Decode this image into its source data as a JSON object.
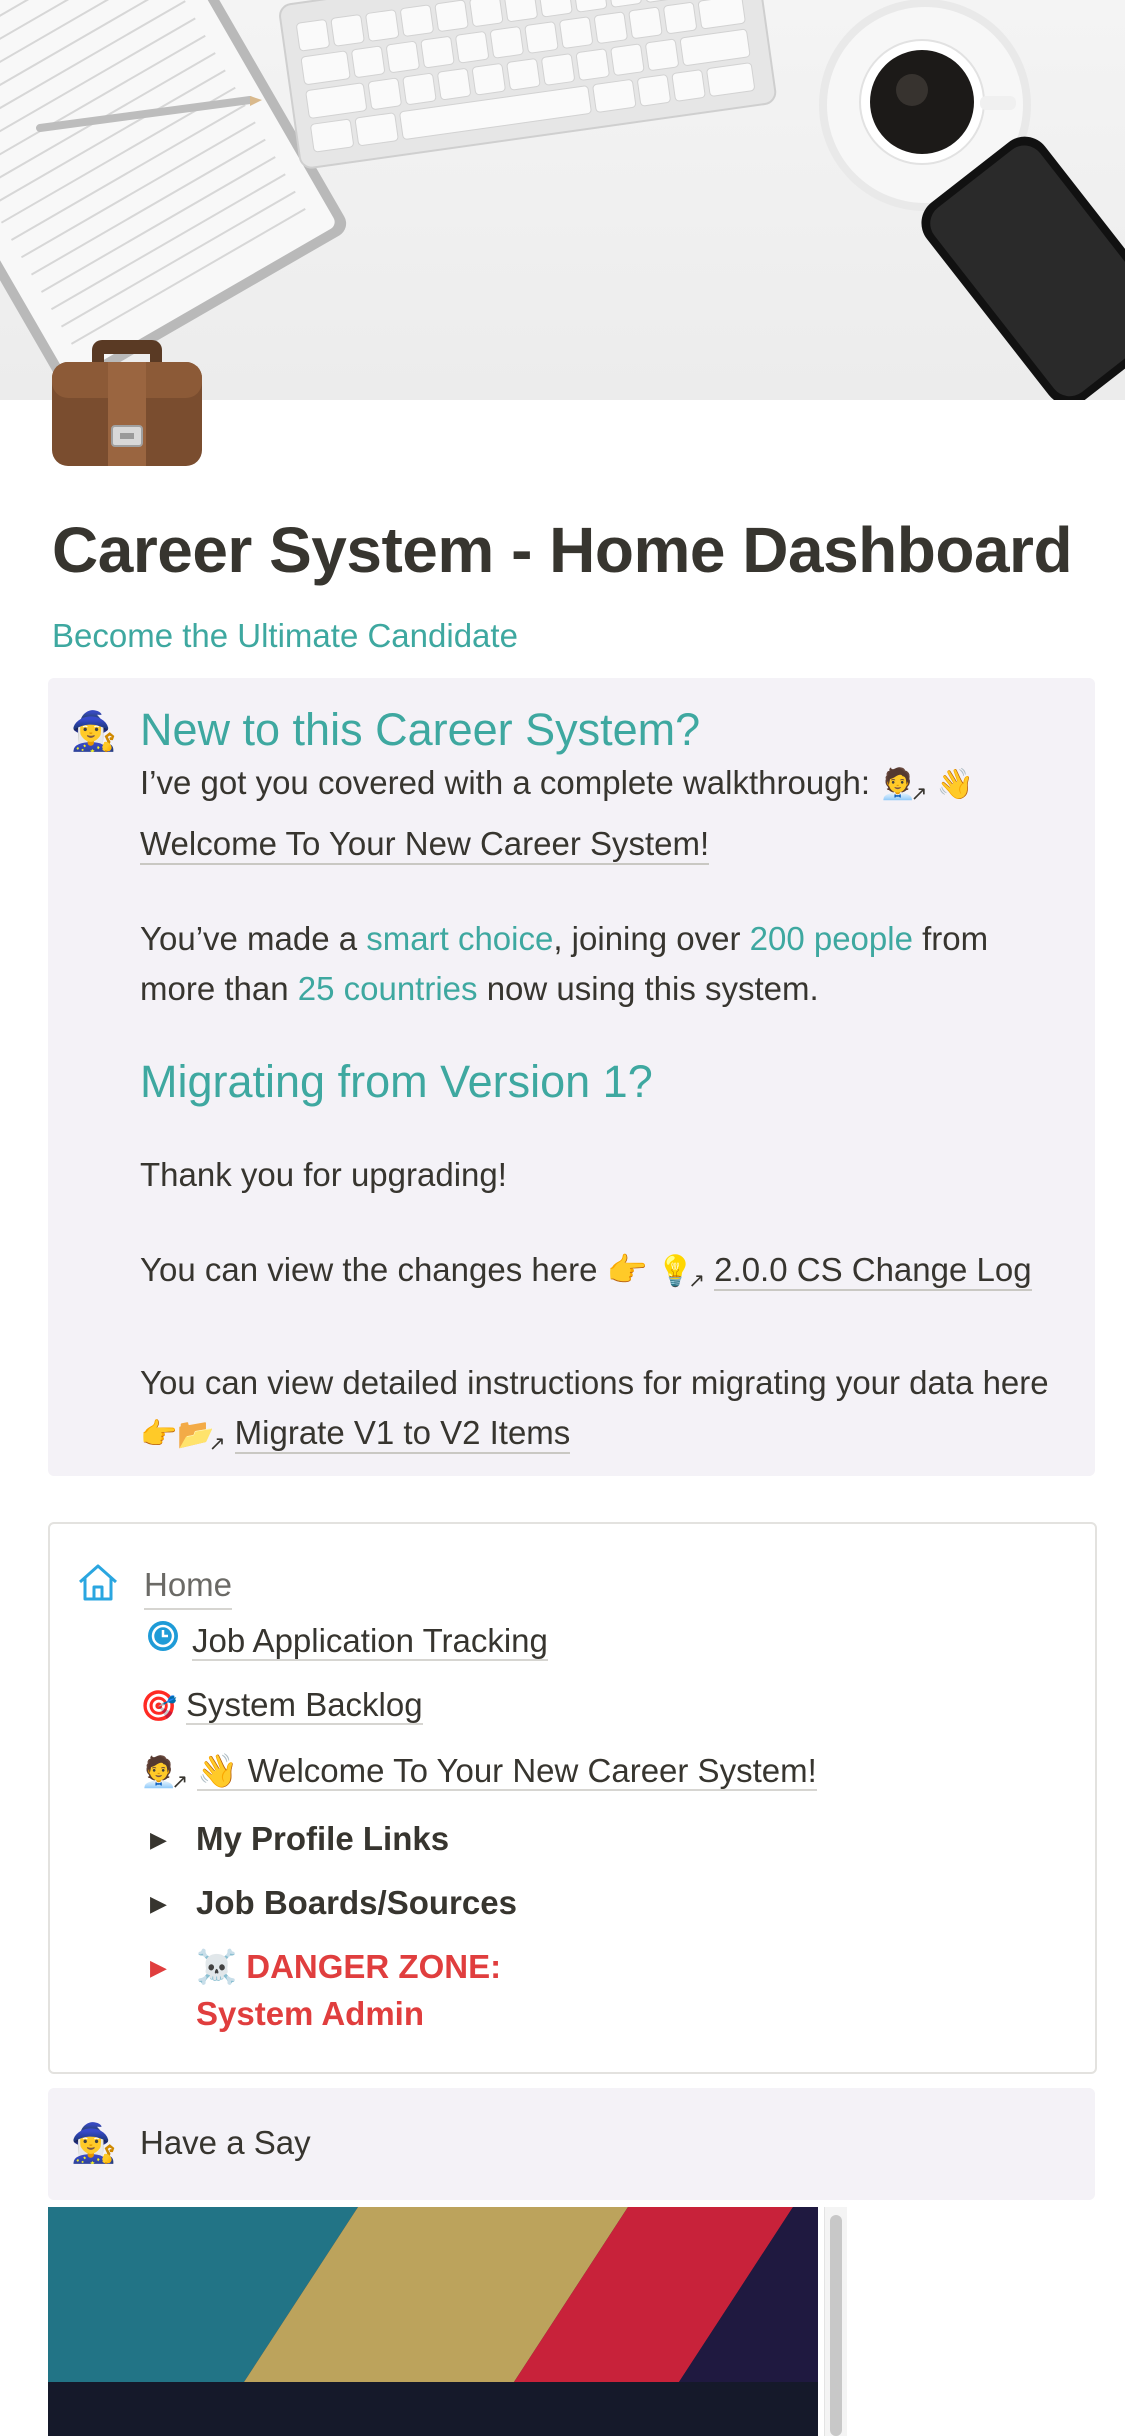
{
  "page": {
    "title": "Career System - Home Dashboard",
    "subtitle": "Become the Ultimate Candidate",
    "icon": "briefcase-icon"
  },
  "callout_intro": {
    "icon": "mage-icon",
    "heading_new": "New to this Career System?",
    "walkthrough_text": "I’ve got you covered with a complete walkthrough: ",
    "walkthrough_link": "Welcome To Your New Career System!",
    "choice_prefix": "You’ve made a ",
    "choice_accent": "smart choice",
    "choice_mid1": ", joining over ",
    "choice_people": "200 people",
    "choice_mid2": " from more than ",
    "choice_countries": "25 countries",
    "choice_suffix": " now using this system.",
    "heading_migrate": "Migrating from Version 1?",
    "thanks": "Thank you for upgrading!",
    "changes_text": "You can view the changes here 👉",
    "changelog_link": "2.0.0 CS Change Log",
    "instructions_text": "You can view detailed instructions for migrating your data here",
    "migrate_link": "Migrate V1 to V2 Items"
  },
  "nav": {
    "home_label": "Home",
    "items": [
      {
        "label": "Job Application Tracking",
        "icon": "clock-icon"
      },
      {
        "label": "System Backlog",
        "icon": "target-icon"
      },
      {
        "label": "Welcome To Your New Career System!",
        "icon": "waving-hand-icon",
        "emoji": "👋"
      }
    ],
    "toggles": [
      {
        "label": "My Profile Links"
      },
      {
        "label": "Job Boards/Sources"
      },
      {
        "label_line1": "☠️ DANGER ZONE:",
        "label_line2": "System Admin"
      }
    ]
  },
  "callout_say": {
    "icon": "mage-icon",
    "text": "Have a Say"
  },
  "colors": {
    "accent": "#3ea8a0",
    "danger": "#e03e3e",
    "callout_bg": "#f4f2f7",
    "text": "#37352f"
  }
}
